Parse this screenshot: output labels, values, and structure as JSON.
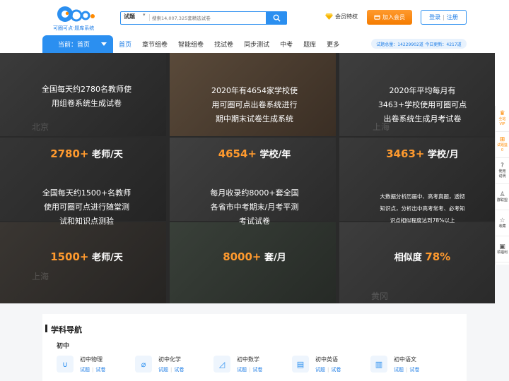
{
  "header": {
    "logo_text": "可圈可点·题库系统",
    "search_type": "试题",
    "search_placeholder": "搜索14,007,325套精选试卷",
    "vip_label": "会员特权",
    "join_label": "加入会员",
    "login_label": "登录",
    "register_label": "注册"
  },
  "nav": {
    "current_label": "当前：首页",
    "items": [
      "首页",
      "章节组卷",
      "智能组卷",
      "找试卷",
      "同步测试",
      "中考",
      "题库",
      "更多"
    ],
    "stats_total": "试题总量：14229902道",
    "stats_today": "今日更新：4217道"
  },
  "banner": {
    "tiles": [
      {
        "line1": "全国每天约2780名教师使",
        "line2": "用组卷系统生成试卷",
        "line3": ""
      },
      {
        "line1": "2020年有4654家学校使",
        "line2": "用可圈可点出卷系统进行",
        "line3": "期中期末试卷生成系统"
      },
      {
        "line1": "2020年平均每月有",
        "line2": "3463+学校使用可圈可点",
        "line3": "出卷系统生成月考试卷"
      },
      {
        "line1": "全国每天约1500+名教师",
        "line2": "使用可圈可点进行随堂测",
        "line3": "试和知识点测验"
      },
      {
        "line1": "每月收录约8000+套全国",
        "line2": "各省市中考期末/月考平测",
        "line3": "考试试卷"
      },
      {
        "line1": "大数据分析历届中、高考真题，透彻",
        "line2": "知识点，分析出中高考常考、必考知",
        "line3": "识点相似程度达到78%以上"
      }
    ],
    "stats": [
      {
        "num": "2780+",
        "unit": " 老师/天"
      },
      {
        "num": "4654+",
        "unit": " 学校/年"
      },
      {
        "num": "3463+",
        "unit": " 学校/月"
      },
      {
        "num": "1500+",
        "unit": " 老师/天"
      },
      {
        "num": "8000+",
        "unit": " 套/月"
      },
      {
        "prefix": "相似度 ",
        "num": "78%",
        "unit": ""
      }
    ],
    "watermarks": [
      "北京",
      "上海",
      "上海",
      "黄冈"
    ]
  },
  "float_bar": {
    "items": [
      {
        "icon": "crown-icon",
        "label1": "全站",
        "label2": "VIP"
      },
      {
        "icon": "cart-icon",
        "label1": "试题篮",
        "label2": "0"
      },
      {
        "icon": "help-icon",
        "label1": "使用",
        "label2": "说明"
      },
      {
        "icon": "user-icon",
        "label1": "群联盟",
        "label2": ""
      },
      {
        "icon": "star-icon",
        "label1": "收藏",
        "label2": ""
      },
      {
        "icon": "gift-icon",
        "label1": "领福利",
        "label2": ""
      }
    ]
  },
  "subjects": {
    "title": "学科导航",
    "level": "初中",
    "items": [
      {
        "name": "初中物理",
        "link1": "试题",
        "link2": "试卷",
        "icon": "magnet-icon"
      },
      {
        "name": "初中化学",
        "link1": "试题",
        "link2": "试卷",
        "icon": "tube-icon"
      },
      {
        "name": "初中数学",
        "link1": "试题",
        "link2": "试卷",
        "icon": "ruler-icon"
      },
      {
        "name": "初中英语",
        "link1": "试题",
        "link2": "试卷",
        "icon": "abc-icon"
      },
      {
        "name": "初中语文",
        "link1": "试题",
        "link2": "试卷",
        "icon": "book-icon"
      }
    ]
  },
  "colors": {
    "brand": "#2b8ff0",
    "accent": "#ff9a2e"
  }
}
